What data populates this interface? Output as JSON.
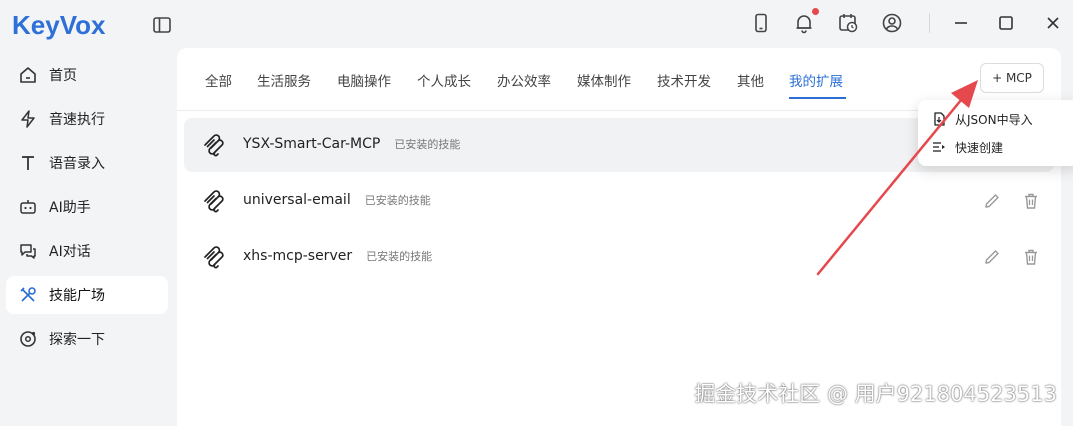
{
  "app": {
    "logo_text": "KeyVox"
  },
  "colors": {
    "accent": "#2b6fd6",
    "brand": "#2e6fd8",
    "notification": "#e5484d",
    "arrow": "#e5484d"
  },
  "topbar": {
    "icons": [
      "phone-icon",
      "bell-icon",
      "calendar-clock-icon",
      "user-circle-icon"
    ],
    "window_controls": [
      "minimize-icon",
      "maximize-icon",
      "close-icon"
    ]
  },
  "sidebar": {
    "items": [
      {
        "label": "首页",
        "icon": "home-icon"
      },
      {
        "label": "音速执行",
        "icon": "lightning-icon"
      },
      {
        "label": "语音录入",
        "icon": "text-t-icon"
      },
      {
        "label": "AI助手",
        "icon": "robot-icon"
      },
      {
        "label": "AI对话",
        "icon": "chat-icon"
      },
      {
        "label": "技能广场",
        "icon": "tools-icon",
        "active": true
      },
      {
        "label": "探索一下",
        "icon": "explore-icon"
      }
    ]
  },
  "tabs": [
    {
      "label": "全部"
    },
    {
      "label": "生活服务"
    },
    {
      "label": "电脑操作"
    },
    {
      "label": "个人成长"
    },
    {
      "label": "办公效率"
    },
    {
      "label": "媒体制作"
    },
    {
      "label": "技术开发"
    },
    {
      "label": "其他"
    },
    {
      "label": "我的扩展",
      "active": true
    }
  ],
  "add_mcp_label": "+ MCP",
  "dropdown": {
    "items": [
      {
        "label": "从JSON中导入",
        "icon": "file-import-icon"
      },
      {
        "label": "快速创建",
        "icon": "quick-create-icon"
      }
    ]
  },
  "rows": [
    {
      "name": "YSX-Smart-Car-MCP",
      "tag": "已安装的技能"
    },
    {
      "name": "universal-email",
      "tag": "已安装的技能"
    },
    {
      "name": "xhs-mcp-server",
      "tag": "已安装的技能"
    }
  ],
  "watermark": "掘金技术社区 @ 用户921804523513"
}
